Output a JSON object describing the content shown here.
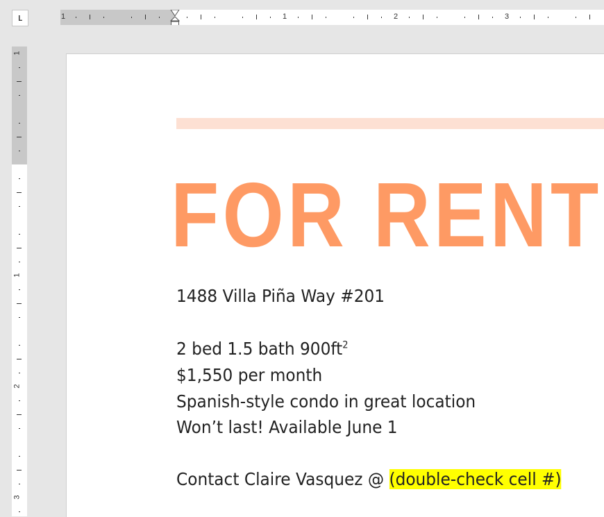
{
  "ruler": {
    "tab_selector": "L",
    "horizontal_labels": [
      "1",
      "1",
      "2",
      "3"
    ],
    "vertical_labels": [
      "1",
      "1",
      "2",
      "3"
    ]
  },
  "document": {
    "title": "FOR RENT",
    "address": "1488 Villa Piña Way #201",
    "details_prefix": "2 bed 1.5 bath 900ft",
    "details_superscript": "2",
    "price": "$1,550 per month",
    "description": "Spanish-style condo in great location",
    "availability": "Won’t last! Available June 1",
    "contact_prefix": "Contact Claire Vasquez @ ",
    "contact_highlight": "(double-check cell #)"
  },
  "colors": {
    "title": "#fe9a64",
    "accent_bar": "#fde0d3",
    "highlight": "#ffff00"
  }
}
